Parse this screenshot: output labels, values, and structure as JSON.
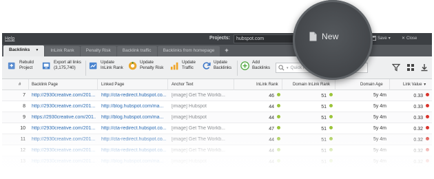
{
  "menubar": {
    "help": "Help",
    "projects_label": "Projects:",
    "project_value": "hubspot.com",
    "items": [
      {
        "label": "Save"
      },
      {
        "label": "Close"
      }
    ]
  },
  "magnifier": {
    "new_label": "New"
  },
  "tabs": [
    {
      "label": "Backlinks",
      "active": true,
      "has_caret": true
    },
    {
      "label": "InLink Rank"
    },
    {
      "label": "Penalty Risk"
    },
    {
      "label": "Backlink traffic"
    },
    {
      "label": "Backlinks from homepage"
    }
  ],
  "toolbar": {
    "rebuild": "Rebuild Project",
    "export": "Export all links (3,175,740)",
    "update_inlink": "Update InLink Rank",
    "update_penalty": "Update Penalty Risk",
    "update_traffic": "Update Traffic",
    "update_backlinks": "Update Backlinks",
    "add_backlinks": "Add Backlinks",
    "filter_placeholder": "Quick Filter: Contains"
  },
  "table": {
    "headers": [
      "#",
      "Backlink Page",
      "Linked Page",
      "Anchor Text",
      "InLink Rank",
      "Domain InLink Rank",
      "Domain Age",
      "Link Value"
    ],
    "rows": [
      {
        "n": "7",
        "backlink": "http://2930creative.com/201...",
        "linked": "http://cta-redirect.hubspot.co...",
        "anchor": "[image] Get The Workb...",
        "ilr": "46",
        "dilr": "51",
        "age": "5y 4m",
        "lv": "0.33"
      },
      {
        "n": "8",
        "backlink": "http://2930creative.com/201...",
        "linked": "http://blog.hubspot.com/ma...",
        "anchor": "[image] Hubspot",
        "ilr": "44",
        "dilr": "51",
        "age": "5y 4m",
        "lv": "0.33"
      },
      {
        "n": "9",
        "backlink": "https://2930creative.com/201...",
        "linked": "http://blog.hubspot.com/ma...",
        "anchor": "[image] Hubspot",
        "ilr": "44",
        "dilr": "51",
        "age": "5y 4m",
        "lv": "0.33"
      },
      {
        "n": "10",
        "backlink": "http://2930creative.com/201...",
        "linked": "http://cta-redirect.hubspot.co...",
        "anchor": "[image] Get The Workb...",
        "ilr": "47",
        "dilr": "51",
        "age": "5y 4m",
        "lv": "0.32"
      },
      {
        "n": "11",
        "backlink": "http://2930creative.com/201...",
        "linked": "http://cta-redirect.hubspot.co...",
        "anchor": "[image] Get The Workb...",
        "ilr": "44",
        "dilr": "51",
        "age": "5y 4m",
        "lv": "0.32"
      },
      {
        "n": "12",
        "backlink": "http://2930creative.com/201...",
        "linked": "http://cta-redirect.hubspot.co...",
        "anchor": "[image] Get The Workb...",
        "ilr": "44",
        "dilr": "51",
        "age": "5y 4m",
        "lv": "0.32"
      },
      {
        "n": "13",
        "backlink": "http://2930creative.com/201...",
        "linked": "http://blog.hubspot.com/ma...",
        "anchor": "[image] Hubspot",
        "ilr": "44",
        "dilr": "51",
        "age": "5y 4m",
        "lv": "0.32"
      }
    ]
  },
  "colors": {
    "green_dot": "#9bc43a",
    "red_dot": "#d9332b",
    "link": "#2a6bb3"
  }
}
